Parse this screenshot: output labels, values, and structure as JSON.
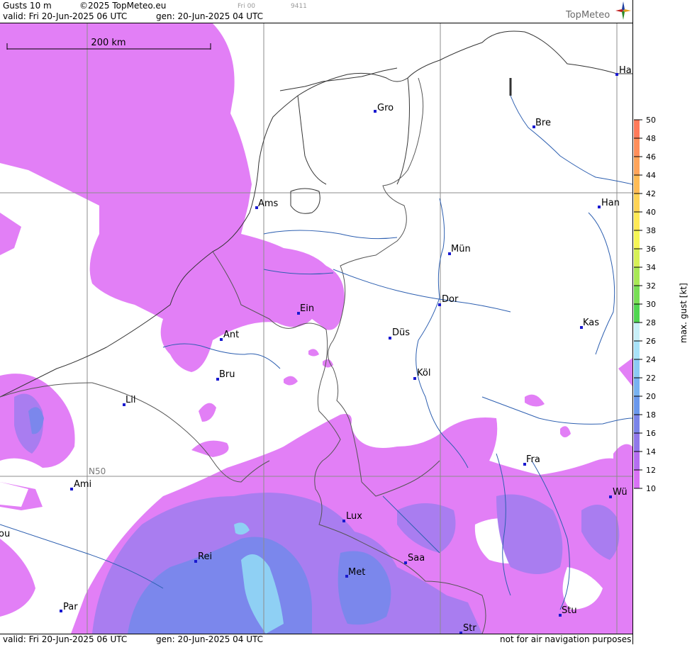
{
  "header": {
    "product": "Gusts 10 m",
    "copyright": "©2025 TopMeteo.eu",
    "run_label": "Fri 00",
    "code": "9411",
    "valid": "valid:  Fri   20-Jun-2025  06 UTC",
    "generated": "gen:  20-Jun-2025  04 UTC",
    "logo": "TopMeteo"
  },
  "footer": {
    "valid": "valid:  Fri   20-Jun-2025  06 UTC",
    "generated": "gen:  20-Jun-2025  04 UTC",
    "disclaimer": "not for air navigation purposes"
  },
  "map": {
    "scale_bar": "200 km",
    "lat_label": "N50",
    "cities": [
      {
        "name": "Gro"
      },
      {
        "name": "Bre"
      },
      {
        "name": "Ha"
      },
      {
        "name": "Ams"
      },
      {
        "name": "Han"
      },
      {
        "name": "Mün"
      },
      {
        "name": "Ein"
      },
      {
        "name": "Dor"
      },
      {
        "name": "Ant"
      },
      {
        "name": "Düs"
      },
      {
        "name": "Kas"
      },
      {
        "name": "Bru"
      },
      {
        "name": "Köl"
      },
      {
        "name": "Lil"
      },
      {
        "name": "Fra"
      },
      {
        "name": "Ami"
      },
      {
        "name": "Wü"
      },
      {
        "name": "Lux"
      },
      {
        "name": "Rei"
      },
      {
        "name": "Saa"
      },
      {
        "name": "Met"
      },
      {
        "name": "ou"
      },
      {
        "name": "Par"
      },
      {
        "name": "Stu"
      },
      {
        "name": "Str"
      }
    ]
  },
  "legend": {
    "title": "max. gust [kt]",
    "ticks": [
      "50",
      "48",
      "46",
      "44",
      "42",
      "40",
      "38",
      "36",
      "34",
      "32",
      "30",
      "28",
      "26",
      "24",
      "22",
      "20",
      "18",
      "16",
      "14",
      "12",
      "10"
    ],
    "colors": [
      "#ff7a5a",
      "#ff8e5a",
      "#ffa45a",
      "#ffbb55",
      "#ffd355",
      "#ffe955",
      "#f5f555",
      "#d6f055",
      "#a8e855",
      "#78de55",
      "#50d650",
      "#c8f0f8",
      "#a8e2f8",
      "#8ccaf4",
      "#78b2f0",
      "#6a98ec",
      "#7a84e8",
      "#9078ea",
      "#b46ef0",
      "#d872f4"
    ],
    "color_meaning": {
      "light": "#e27ff6",
      "medium": "#a97df0",
      "strong": "#7b87ec",
      "cyan": "#8fd0f4"
    }
  }
}
